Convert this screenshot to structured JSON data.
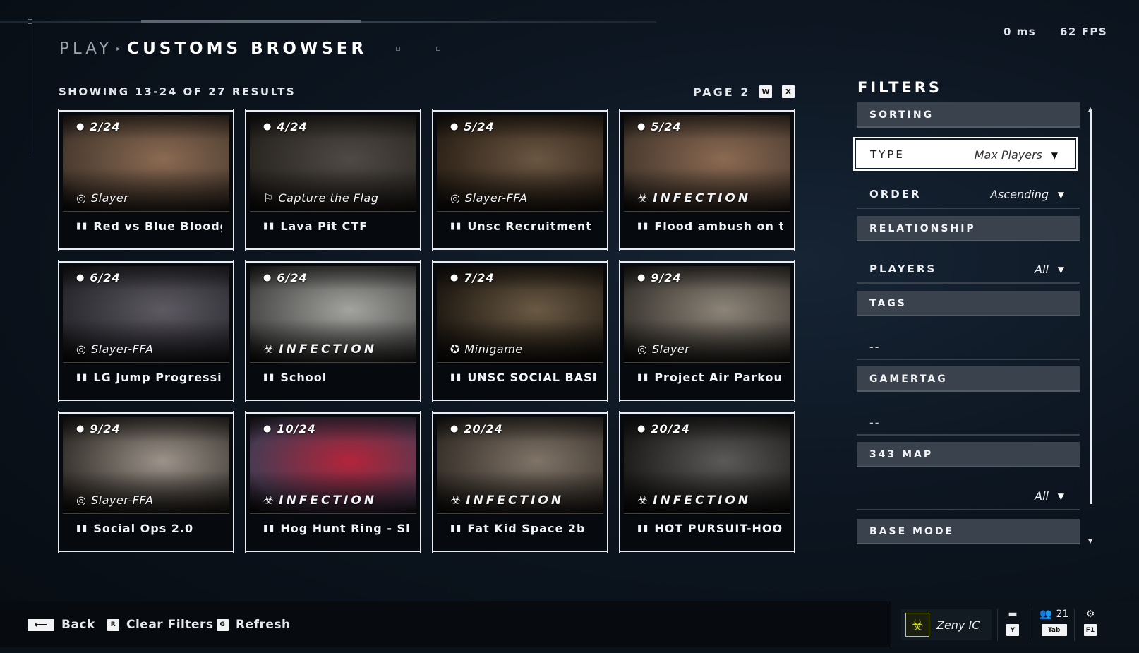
{
  "header": {
    "breadcrumb_parent": "PLAY",
    "breadcrumb_separator": "▸",
    "breadcrumb_current": "CUSTOMS BROWSER"
  },
  "perf": {
    "latency": "0 ms",
    "fps": "62 FPS"
  },
  "results": {
    "showing": "SHOWING 13-24 OF 27 RESULTS",
    "page": "PAGE 2",
    "prev_key": "W",
    "next_key": "X"
  },
  "cards": [
    {
      "players": "2/24",
      "mode": "Slayer",
      "mode_icon": "slayer-icon",
      "title": "Red vs Blue Bloodgu",
      "colors": [
        "#8b6a52",
        "#4a3b30"
      ]
    },
    {
      "players": "4/24",
      "mode": "Capture the Flag",
      "mode_icon": "flag-icon",
      "title": "Lava Pit CTF",
      "colors": [
        "#4f4a45",
        "#2a2622"
      ]
    },
    {
      "players": "5/24",
      "mode": "Slayer-FFA",
      "mode_icon": "slayer-icon",
      "title": "Unsc Recruitment",
      "colors": [
        "#6b5642",
        "#2f2419"
      ]
    },
    {
      "players": "5/24",
      "mode": "INFECTION",
      "mode_icon": "biohazard-icon",
      "title": "Flood ambush on thi",
      "colors": [
        "#8b6a52",
        "#4a3b30"
      ]
    },
    {
      "players": "6/24",
      "mode": "Slayer-FFA",
      "mode_icon": "slayer-icon",
      "title": "LG Jump Progressio",
      "colors": [
        "#5d5a62",
        "#2b2a30"
      ]
    },
    {
      "players": "6/24",
      "mode": "INFECTION",
      "mode_icon": "biohazard-icon",
      "title": "School",
      "colors": [
        "#a3a3a0",
        "#4c4c4a"
      ]
    },
    {
      "players": "7/24",
      "mode": "Minigame",
      "mode_icon": "minigame-icon",
      "title": "UNSC SOCIAL BASE",
      "colors": [
        "#6a5a44",
        "#231c14"
      ]
    },
    {
      "players": "9/24",
      "mode": "Slayer",
      "mode_icon": "slayer-icon",
      "title": "Project Air Parkour",
      "colors": [
        "#8d8478",
        "#3e3a34"
      ]
    },
    {
      "players": "9/24",
      "mode": "Slayer-FFA",
      "mode_icon": "slayer-icon",
      "title": "Social Ops 2.0",
      "colors": [
        "#9c938a",
        "#3b3631"
      ]
    },
    {
      "players": "10/24",
      "mode": "INFECTION",
      "mode_icon": "biohazard-icon",
      "title": "Hog Hunt Ring - Ske",
      "colors": [
        "#b3243a",
        "#4a3a52"
      ]
    },
    {
      "players": "20/24",
      "mode": "INFECTION",
      "mode_icon": "biohazard-icon",
      "title": "Fat Kid Space 2b",
      "colors": [
        "#807468",
        "#3a332c"
      ]
    },
    {
      "players": "20/24",
      "mode": "INFECTION",
      "mode_icon": "biohazard-icon",
      "title": "HOT PURSUIT-HOOV",
      "colors": [
        "#5c5a58",
        "#1e1d1c"
      ]
    }
  ],
  "filters": {
    "title": "FILTERS",
    "sorting": "SORTING",
    "type_label": "TYPE",
    "type_value": "Max Players",
    "order_label": "ORDER",
    "order_value": "Ascending",
    "relationship": "RELATIONSHIP",
    "players_label": "PLAYERS",
    "players_value": "All",
    "tags": "TAGS",
    "tags_value": "--",
    "gamertag": "GAMERTAG",
    "gamertag_value": "--",
    "map": "343 MAP",
    "map_value": "All",
    "base_mode": "BASE MODE"
  },
  "footer": {
    "back_key": "⟵",
    "back": "Back",
    "clear_key": "R",
    "clear": "Clear Filters",
    "refresh_key": "G",
    "refresh": "Refresh",
    "gamertag": "Zeny IC",
    "chat_key": "Y",
    "friends_count": "21",
    "friends_key": "Tab",
    "settings_key": "F1"
  }
}
